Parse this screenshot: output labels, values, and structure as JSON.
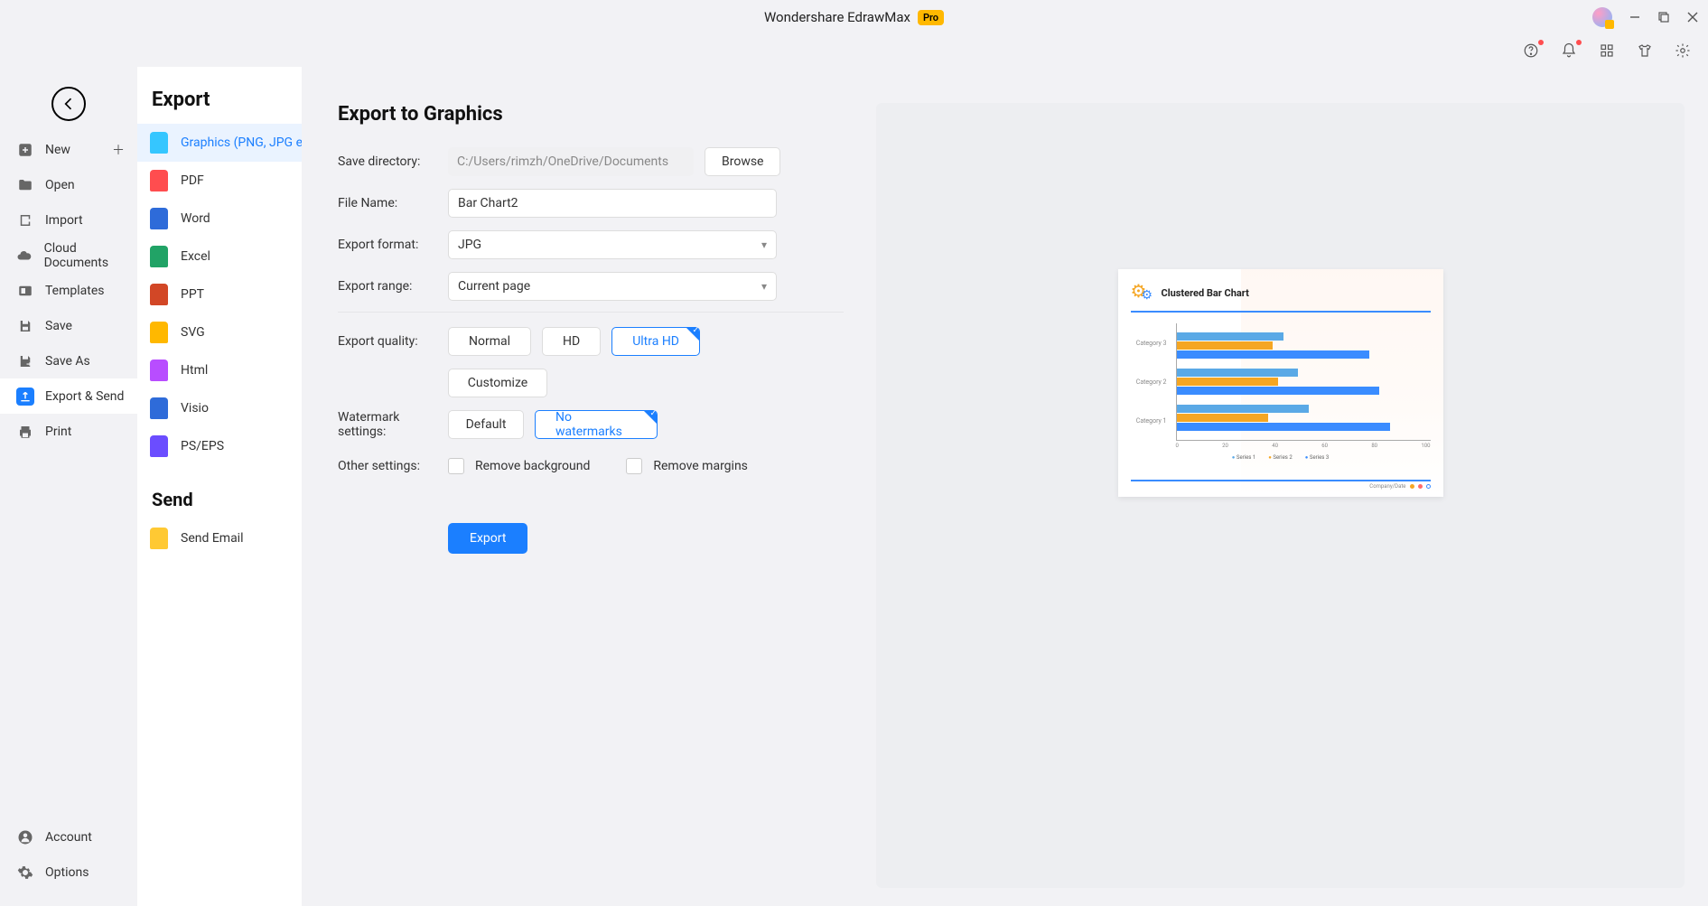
{
  "app": {
    "title": "Wondershare EdrawMax",
    "badge": "Pro"
  },
  "nav": {
    "items": [
      {
        "label": "New",
        "icon": "plus-square"
      },
      {
        "label": "Open",
        "icon": "folder"
      },
      {
        "label": "Import",
        "icon": "import"
      },
      {
        "label": "Cloud Documents",
        "icon": "cloud"
      },
      {
        "label": "Templates",
        "icon": "template"
      },
      {
        "label": "Save",
        "icon": "save"
      },
      {
        "label": "Save As",
        "icon": "save-as"
      },
      {
        "label": "Export & Send",
        "icon": "export",
        "active": true
      },
      {
        "label": "Print",
        "icon": "print"
      }
    ],
    "footer": [
      {
        "label": "Account",
        "icon": "user"
      },
      {
        "label": "Options",
        "icon": "gear"
      }
    ]
  },
  "panel": {
    "heading_export": "Export",
    "heading_send": "Send",
    "export_items": [
      {
        "label": "Graphics (PNG, JPG et…",
        "icon": "img",
        "active": true
      },
      {
        "label": "PDF",
        "icon": "pdf"
      },
      {
        "label": "Word",
        "icon": "word"
      },
      {
        "label": "Excel",
        "icon": "excel"
      },
      {
        "label": "PPT",
        "icon": "ppt"
      },
      {
        "label": "SVG",
        "icon": "svg"
      },
      {
        "label": "Html",
        "icon": "html"
      },
      {
        "label": "Visio",
        "icon": "visio"
      },
      {
        "label": "PS/EPS",
        "icon": "ps"
      }
    ],
    "send_items": [
      {
        "label": "Send Email",
        "icon": "mail"
      }
    ]
  },
  "form": {
    "title": "Export to Graphics",
    "labels": {
      "save_dir": "Save directory:",
      "file_name": "File Name:",
      "format": "Export format:",
      "range": "Export range:",
      "quality": "Export quality:",
      "watermark": "Watermark settings:",
      "other": "Other settings:"
    },
    "values": {
      "save_dir": "C:/Users/rimzh/OneDrive/Documents",
      "file_name": "Bar Chart2",
      "format": "JPG",
      "range": "Current page",
      "quality": [
        "Normal",
        "HD",
        "Ultra HD"
      ],
      "quality_selected": 2,
      "customize": "Customize",
      "watermark": [
        "Default",
        "No watermarks"
      ],
      "watermark_selected": 1,
      "remove_bg": "Remove background",
      "remove_margins": "Remove margins"
    },
    "buttons": {
      "browse": "Browse",
      "export": "Export"
    }
  },
  "chart_data": {
    "type": "bar",
    "orientation": "horizontal",
    "title": "Clustered Bar Chart",
    "categories": [
      "Category 3",
      "Category 2",
      "Category 1"
    ],
    "series": [
      {
        "name": "Series 1",
        "color": "#5aa9e6",
        "values": [
          42,
          48,
          52
        ]
      },
      {
        "name": "Series 2",
        "color": "#f5a623",
        "values": [
          38,
          40,
          36
        ]
      },
      {
        "name": "Series 3",
        "color": "#3a8cff",
        "values": [
          76,
          80,
          84
        ]
      }
    ],
    "xlim": [
      0,
      100
    ],
    "x_ticks": [
      0,
      20,
      40,
      60,
      80,
      100
    ],
    "footer_text": "Company/Date"
  }
}
